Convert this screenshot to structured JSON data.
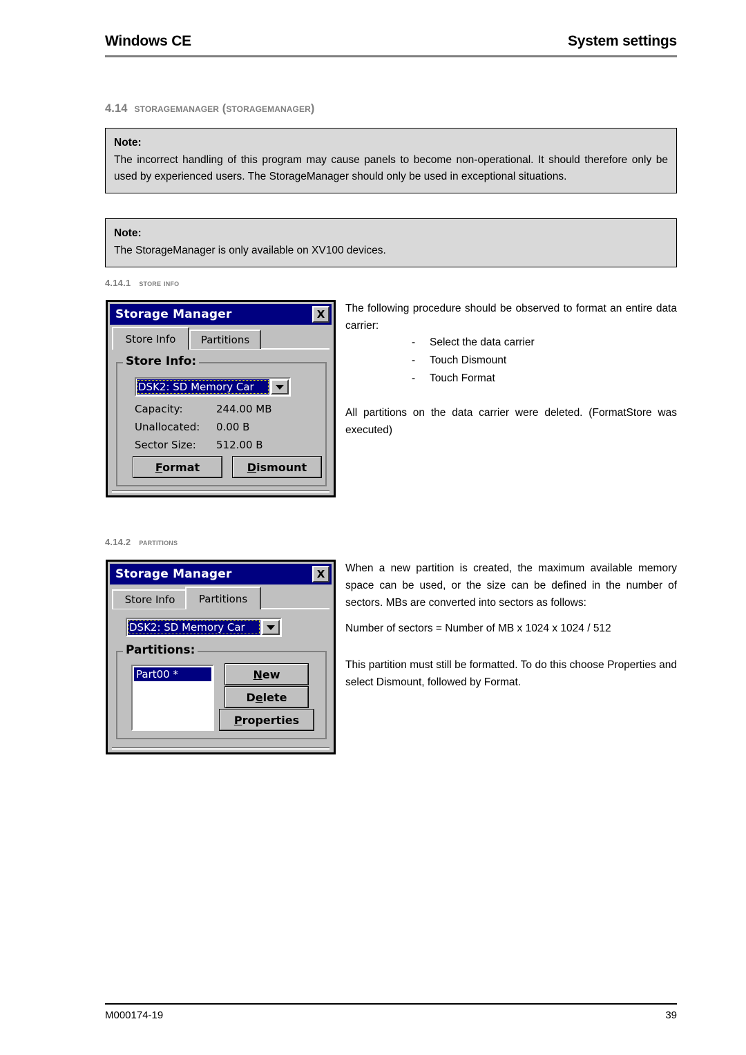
{
  "header": {
    "left_title": "Windows CE",
    "right_title": "System settings"
  },
  "section": {
    "number": "4.14",
    "title": "StorageManager (StorageManager)"
  },
  "notes": [
    {
      "label": "Note:",
      "text": "The incorrect handling of this program may cause panels to become non-operational. It should therefore only be used by experienced users. The StorageManager should only be used in exceptional situations."
    },
    {
      "label": "Note:",
      "text": "The StorageManager is only available on XV100 devices."
    }
  ],
  "subsections": [
    {
      "number": "4.14.1",
      "title": "Store Info"
    },
    {
      "number": "4.14.2",
      "title": "Partitions"
    }
  ],
  "store_info_text": {
    "intro": "The following procedure should be observed to format an entire data carrier:",
    "steps": [
      {
        "marker": "-",
        "text": "Select the data carrier"
      },
      {
        "marker": "-",
        "text": "Touch Dismount"
      },
      {
        "marker": "-",
        "text": "Touch Format"
      }
    ],
    "after": "All partitions on the data carrier were deleted. (FormatStore was executed)"
  },
  "partitions_text": {
    "paragraph1": "When a new partition is created, the maximum available memory space can be used, or the size can be defined in the number of sectors. MBs are converted into sectors as follows:",
    "formula": "Number of sectors = Number of MB x 1024 x 1024 / 512",
    "paragraph2": "This partition must still be formatted. To do this choose Properties and select Dismount, followed by Format."
  },
  "dialog_store_info": {
    "title": "Storage Manager",
    "close_label": "X",
    "tabs": [
      {
        "label": "Store Info",
        "active": true
      },
      {
        "label": "Partitions",
        "active": false
      }
    ],
    "group_label": "Store Info:",
    "combo_value": "DSK2: SD Memory Car",
    "rows": [
      {
        "label": "Capacity:",
        "value": "244.00 MB"
      },
      {
        "label": "Unallocated:",
        "value": "0.00 B"
      },
      {
        "label": "Sector Size:",
        "value": "512.00 B"
      }
    ],
    "buttons": [
      {
        "accel": "F",
        "rest": "ormat"
      },
      {
        "accel": "D",
        "rest": "ismount"
      }
    ]
  },
  "dialog_partitions": {
    "title": "Storage Manager",
    "close_label": "X",
    "tabs": [
      {
        "label": "Store Info",
        "active": false
      },
      {
        "label": "Partitions",
        "active": true
      }
    ],
    "group_label": "Partitions:",
    "combo_value": "DSK2: SD Memory Car",
    "list_items": [
      "Part00 *"
    ],
    "buttons": [
      {
        "pre": "",
        "accel": "N",
        "rest": "ew"
      },
      {
        "pre": "D",
        "accel": "e",
        "rest": "lete"
      },
      {
        "pre": "",
        "accel": "P",
        "rest": "roperties"
      }
    ]
  },
  "footer": {
    "doc_id": "M000174-19",
    "page_number": "39"
  },
  "colors": {
    "titlebar": "#000080",
    "dialog_face": "#c0c0c0",
    "note_bg": "#d9d9d9",
    "heading_gray": "#7f7f7f",
    "focus_outline": "#ffff00"
  }
}
